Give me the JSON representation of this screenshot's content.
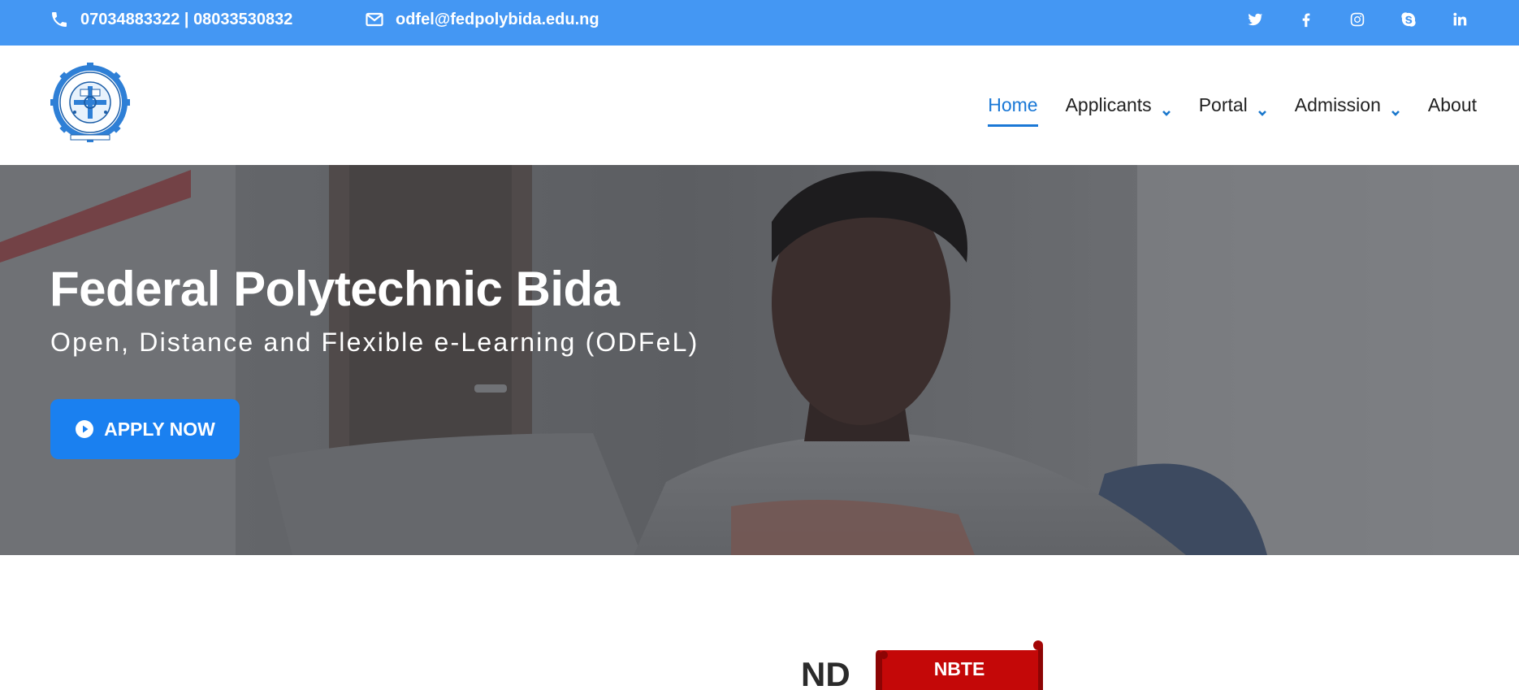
{
  "topbar": {
    "phone": "07034883322 | 08033530832",
    "email": "odfel@fedpolybida.edu.ng",
    "social": [
      "twitter-icon",
      "facebook-icon",
      "instagram-icon",
      "skype-icon",
      "linkedin-icon"
    ]
  },
  "nav": {
    "items": [
      {
        "label": "Home",
        "active": true
      },
      {
        "label": "Applicants"
      },
      {
        "label": "Portal"
      },
      {
        "label": "Admission"
      },
      {
        "label": "About"
      }
    ]
  },
  "hero": {
    "title": "Federal Polytechnic Bida",
    "subtitle": "Open, Distance and Flexible e-Learning (ODFeL)",
    "apply_label": "APPLY NOW"
  },
  "section": {
    "nd_label": "ND",
    "nbte_label": "NBTE"
  },
  "colors": {
    "topbar": "#4497f3",
    "accent": "#1a78d6",
    "button": "#1a80f0",
    "banner": "#c40808"
  }
}
